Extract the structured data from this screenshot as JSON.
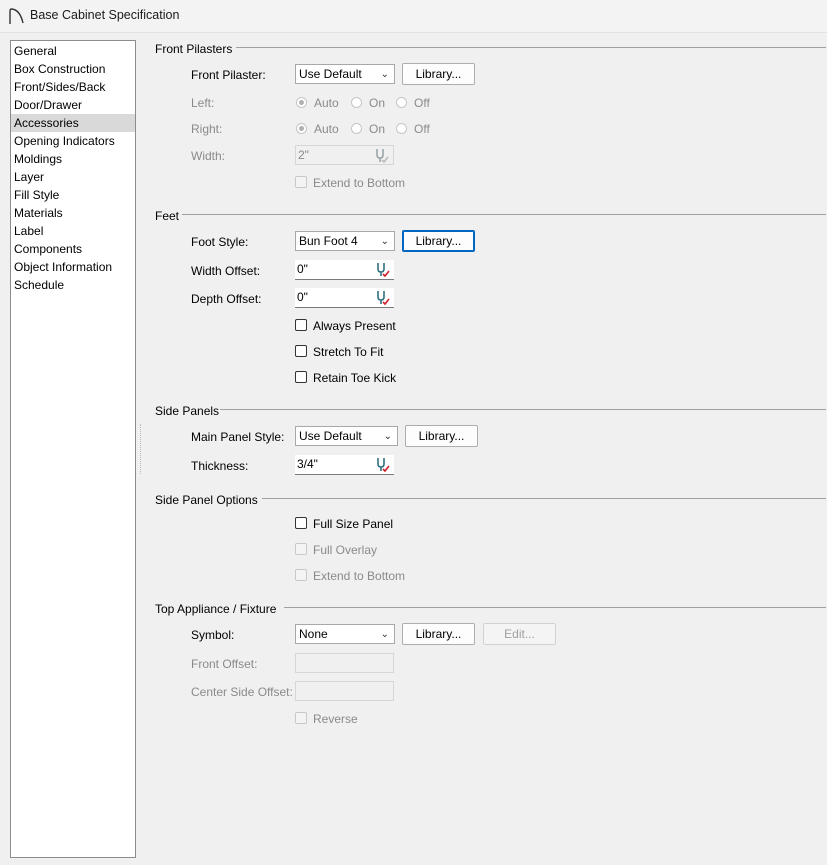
{
  "window": {
    "title": "Base Cabinet Specification"
  },
  "sidebar": {
    "items": [
      "General",
      "Box Construction",
      "Front/Sides/Back",
      "Door/Drawer",
      "Accessories",
      "Opening Indicators",
      "Moldings",
      "Layer",
      "Fill Style",
      "Materials",
      "Label",
      "Components",
      "Object Information",
      "Schedule"
    ],
    "selected": "Accessories"
  },
  "front_pilasters": {
    "title": "Front Pilasters",
    "pilaster_label": "Front Pilaster:",
    "pilaster_value": "Use Default",
    "library_label": "Library...",
    "left_label": "Left:",
    "right_label": "Right:",
    "opt_auto": "Auto",
    "opt_on": "On",
    "opt_off": "Off",
    "width_label": "Width:",
    "width_value": "2\"",
    "extend_label": "Extend to Bottom"
  },
  "feet": {
    "title": "Feet",
    "foot_style_label": "Foot Style:",
    "foot_style_value": "Bun Foot 4",
    "library_label": "Library...",
    "width_offset_label": "Width Offset:",
    "width_offset_value": "0\"",
    "depth_offset_label": "Depth Offset:",
    "depth_offset_value": "0\"",
    "always_present_label": "Always Present",
    "stretch_label": "Stretch To Fit",
    "retain_label": "Retain Toe Kick"
  },
  "side_panels": {
    "title": "Side Panels",
    "main_style_label": "Main Panel Style:",
    "main_style_value": "Use Default",
    "library_label": "Library...",
    "thickness_label": "Thickness:",
    "thickness_value": "3/4\""
  },
  "side_panel_options": {
    "title": "Side Panel Options",
    "full_size_label": "Full Size Panel",
    "full_overlay_label": "Full Overlay",
    "extend_label": "Extend to Bottom"
  },
  "top_appliance": {
    "title": "Top Appliance / Fixture",
    "symbol_label": "Symbol:",
    "symbol_value": "None",
    "library_label": "Library...",
    "edit_label": "Edit...",
    "front_offset_label": "Front Offset:",
    "center_side_offset_label": "Center Side Offset:",
    "reverse_label": "Reverse"
  },
  "icons": {
    "app": "cabinet-arc-icon",
    "field_edit": "wrench-check-icon",
    "dropdown": "chevron-down-icon"
  },
  "colors": {
    "focus": "#0067c0",
    "selected_row": "#d9d9d9",
    "check_red": "#d0202a",
    "icon_teal": "#2f6f7e"
  }
}
